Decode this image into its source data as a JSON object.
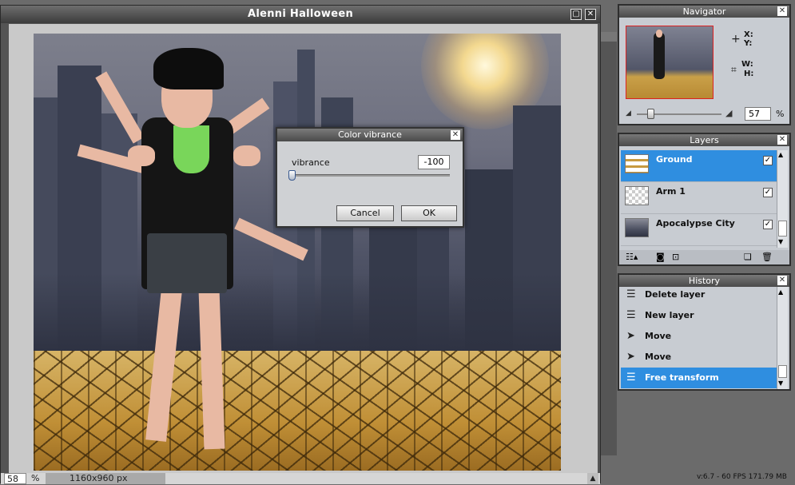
{
  "document": {
    "title": "Alenni Halloween",
    "zoom_value": "58",
    "zoom_unit": "%",
    "dimensions": "1160x960 px"
  },
  "dialog": {
    "title": "Color vibrance",
    "label": "vibrance",
    "value": "-100",
    "slider_fraction": 0.0,
    "cancel_label": "Cancel",
    "ok_label": "OK"
  },
  "navigator": {
    "title": "Navigator",
    "x_label": "X:",
    "y_label": "Y:",
    "w_label": "W:",
    "h_label": "H:",
    "zoom_value": "57",
    "zoom_unit": "%"
  },
  "layers": {
    "title": "Layers",
    "items": [
      {
        "name": "Ground",
        "visible": "✓",
        "selected": true
      },
      {
        "name": "Arm 1",
        "visible": "✓",
        "selected": false
      },
      {
        "name": "Apocalypse City",
        "visible": "✓",
        "selected": false
      }
    ]
  },
  "history": {
    "title": "History",
    "items": [
      {
        "label": "Delete layer",
        "selected": false
      },
      {
        "label": "New layer",
        "selected": false
      },
      {
        "label": "Move",
        "selected": false
      },
      {
        "label": "Move",
        "selected": false
      },
      {
        "label": "Free transform",
        "selected": true
      }
    ]
  },
  "footer": {
    "version_info": "v:6.7 - 60 FPS 171.79 MB"
  },
  "colors": {
    "selection": "#2f8ee0",
    "panel_bg": "#c8ccd2",
    "title_bar": "#4a4a4a"
  }
}
